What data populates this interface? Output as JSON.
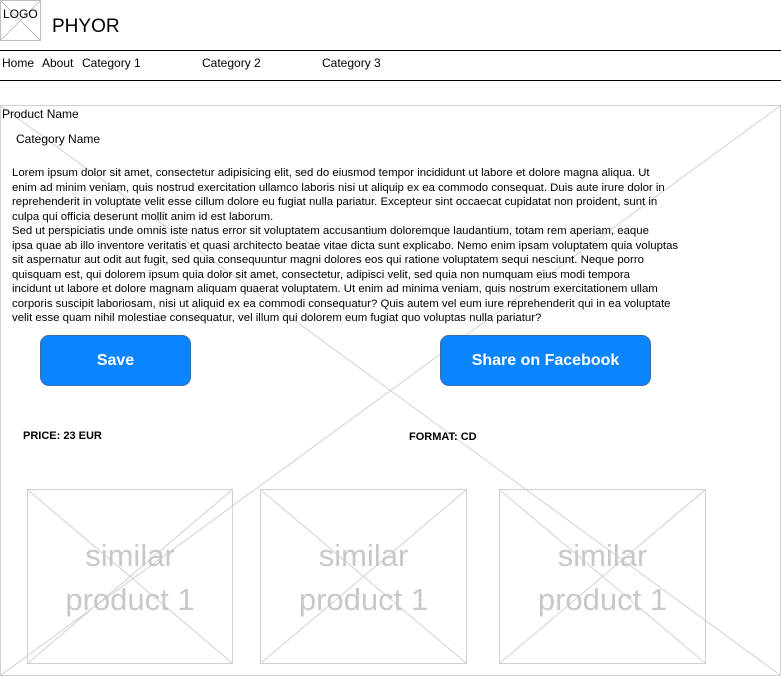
{
  "header": {
    "logo_label": "LOGO",
    "brand": "PHYOR"
  },
  "nav": {
    "items": [
      {
        "label": "Home"
      },
      {
        "label": "About"
      },
      {
        "label": "Category 1"
      },
      {
        "label": "Category 2"
      },
      {
        "label": "Category 3"
      }
    ]
  },
  "product": {
    "name": "Product Name",
    "category": "Category Name",
    "description": "Lorem ipsum dolor sit amet, consectetur adipisicing elit, sed do eiusmod tempor incididunt ut labore et dolore magna aliqua. Ut\nenim ad minim veniam, quis nostrud exercitation ullamco laboris nisi ut aliquip ex ea commodo consequat. Duis aute irure dolor in\nreprehenderit in voluptate velit esse cillum dolore eu fugiat nulla pariatur. Excepteur sint occaecat cupidatat non proident, sunt in\nculpa qui officia deserunt mollit anim id est laborum.\nSed ut perspiciatis unde omnis iste natus error sit voluptatem accusantium doloremque laudantium, totam rem aperiam, eaque\nipsa quae ab illo inventore veritatis et quasi architecto beatae vitae dicta sunt explicabo. Nemo enim ipsam voluptatem quia voluptas\nsit aspernatur aut odit aut fugit, sed quia consequuntur magni dolores eos qui ratione voluptatem sequi nesciunt. Neque porro\nquisquam est, qui dolorem ipsum quia dolor sit amet, consectetur, adipisci velit, sed quia non numquam eius modi tempora\nincidunt ut labore et dolore magnam aliquam quaerat voluptatem. Ut enim ad minima veniam, quis nostrum exercitationem ullam\ncorporis suscipit laboriosam, nisi ut aliquid ex ea commodi consequatur? Quis autem vel eum iure reprehenderit qui in ea voluptate\nvelit esse quam nihil molestiae consequatur, vel illum qui dolorem eum fugiat quo voluptas nulla pariatur?",
    "save_label": "Save",
    "share_label": "Share on Facebook",
    "price": "PRICE: 23 EUR",
    "format": "FORMAT: CD"
  },
  "similar_products": [
    {
      "label": "similar\nproduct 1"
    },
    {
      "label": "similar\nproduct 1"
    },
    {
      "label": "similar\nproduct 1"
    }
  ],
  "colors": {
    "button_blue": "#0a84ff",
    "button_border": "#3a6ea5",
    "placeholder_gray": "#d0d0d0",
    "similar_text_gray": "#c8c8c8"
  }
}
